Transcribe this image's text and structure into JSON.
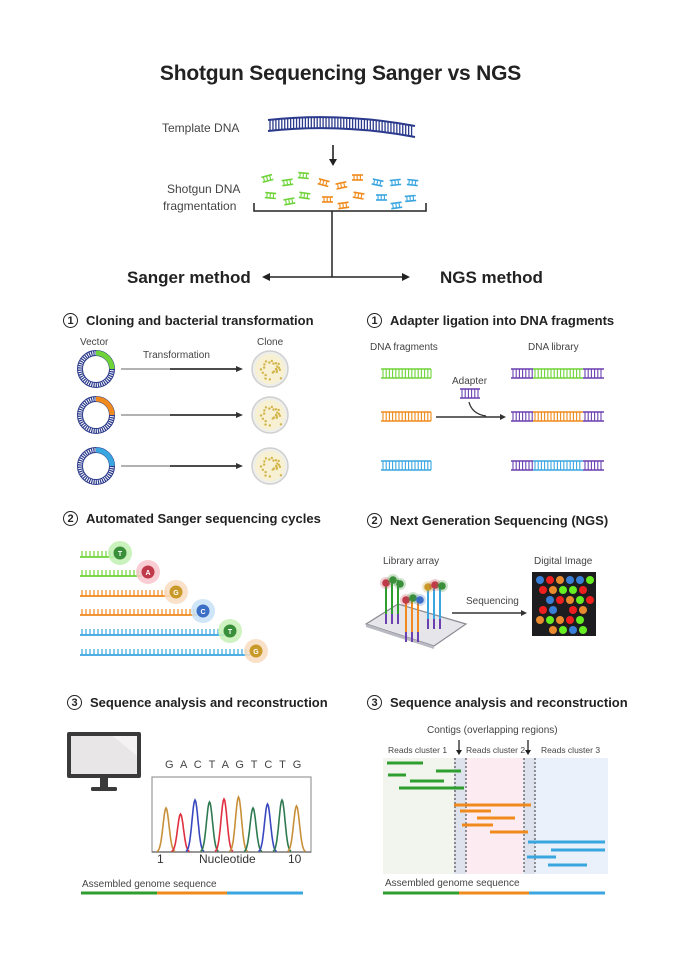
{
  "title": "Shotgun Sequencing Sanger vs NGS",
  "top": {
    "template_label": "Template DNA",
    "fragmentation_label_1": "Shotgun DNA",
    "fragmentation_label_2": "fragmentation"
  },
  "methods": {
    "sanger": "Sanger method",
    "ngs": "NGS method"
  },
  "sanger": {
    "step1": {
      "num": "1",
      "title": "Cloning and bacterial transformation",
      "vector_label": "Vector",
      "transformation_label": "Transformation",
      "clone_label": "Clone"
    },
    "step2": {
      "num": "2",
      "title": "Automated Sanger sequencing cycles",
      "bases": [
        "T",
        "A",
        "G",
        "C",
        "T",
        "G"
      ]
    },
    "step3": {
      "num": "3",
      "title": "Sequence analysis and reconstruction",
      "sequence": "G A C T A G T C T G",
      "axis_start": "1",
      "axis_label": "Nucleotide",
      "axis_end": "10",
      "assembled_label": "Assembled genome sequence"
    }
  },
  "ngs": {
    "step1": {
      "num": "1",
      "title": "Adapter ligation into DNA fragments",
      "fragments_label": "DNA fragments",
      "library_label": "DNA library",
      "adapter_label": "Adapter"
    },
    "step2": {
      "num": "2",
      "title": "Next Generation Sequencing (NGS)",
      "array_label": "Library array",
      "sequencing_label": "Sequencing",
      "image_label": "Digital Image"
    },
    "step3": {
      "num": "3",
      "title": "Sequence analysis and reconstruction",
      "contigs_label": "Contigs (overlapping regions)",
      "cluster1": "Reads cluster 1",
      "cluster2": "Reads cluster 2",
      "cluster3": "Reads cluster 3",
      "assembled_label": "Assembled genome sequence"
    }
  },
  "colors": {
    "green": "#2e9e2e",
    "lightgreen": "#6fd33a",
    "orange": "#f08a1c",
    "blue": "#3aa6e0",
    "navy": "#2b3a8c",
    "purple": "#6a3fb0"
  }
}
